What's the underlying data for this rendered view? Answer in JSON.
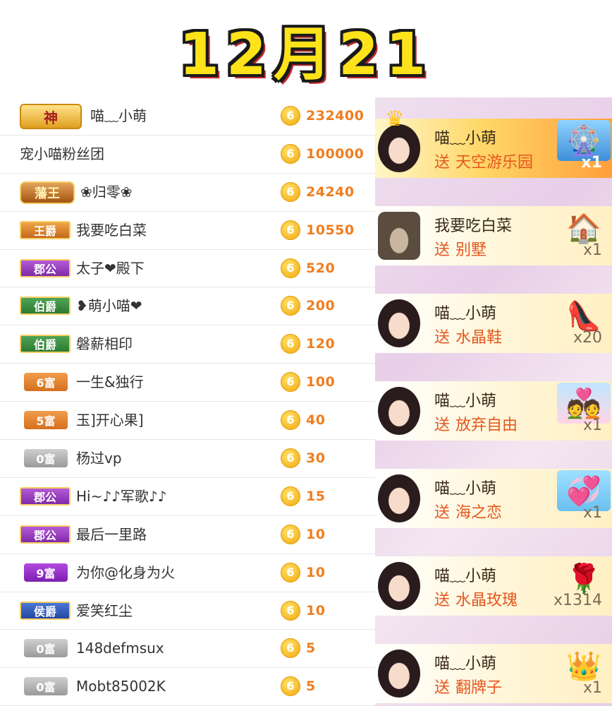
{
  "title": "12月21",
  "coin_glyph": "6",
  "ranking": [
    {
      "badge": "神",
      "badge_type": "god",
      "name": "喵﹏小萌",
      "score": "232400"
    },
    {
      "badge": "",
      "badge_type": "none",
      "name": "宠小喵粉丝团",
      "score": "100000"
    },
    {
      "badge": "藩王",
      "badge_type": "king",
      "name": "❀归零❀",
      "score": "24240"
    },
    {
      "badge": "王爵",
      "badge_type": "wang",
      "name": "我要吃白菜",
      "score": "10550"
    },
    {
      "badge": "郡公",
      "badge_type": "jun",
      "name": "太子❤殿下",
      "score": "520"
    },
    {
      "badge": "伯爵",
      "badge_type": "bo",
      "name": "❥萌小喵❤",
      "score": "200"
    },
    {
      "badge": "伯爵",
      "badge_type": "bo",
      "name": "磐薪相印",
      "score": "120"
    },
    {
      "badge": "6富",
      "badge_type": "fu6",
      "name": "一生&独行",
      "score": "100"
    },
    {
      "badge": "5富",
      "badge_type": "fu5",
      "name": "玉]开心果]",
      "score": "40"
    },
    {
      "badge": "0富",
      "badge_type": "fu0",
      "name": "杨过vp",
      "score": "30"
    },
    {
      "badge": "郡公",
      "badge_type": "jun",
      "name": "Hi~♪♪军歌♪♪",
      "score": "15"
    },
    {
      "badge": "郡公",
      "badge_type": "jun",
      "name": "最后一里路",
      "score": "10"
    },
    {
      "badge": "9富",
      "badge_type": "fu9",
      "name": "为你@化身为火",
      "score": "10"
    },
    {
      "badge": "侯爵",
      "badge_type": "hou",
      "name": "爱笑红尘",
      "score": "10"
    },
    {
      "badge": "0富",
      "badge_type": "fu0",
      "name": "148defmsux",
      "score": "5"
    },
    {
      "badge": "0富",
      "badge_type": "fu0",
      "name": "Mobt85002K",
      "score": "5"
    }
  ],
  "gifts": [
    {
      "user": "喵﹏小萌",
      "send_label": "送",
      "gift": "天空游乐园",
      "count": "x1",
      "icon": "amusement-park-icon",
      "avatar": "female",
      "crown": true
    },
    {
      "user": "我要吃白菜",
      "send_label": "送",
      "gift": "别墅",
      "count": "x1",
      "icon": "villa-icon",
      "avatar": "male",
      "crown": false
    },
    {
      "user": "喵﹏小萌",
      "send_label": "送",
      "gift": "水晶鞋",
      "count": "x20",
      "icon": "crystal-shoe-icon",
      "avatar": "female",
      "crown": false
    },
    {
      "user": "喵﹏小萌",
      "send_label": "送",
      "gift": "放弃自由",
      "count": "x1",
      "icon": "couple-icon",
      "avatar": "female",
      "crown": false
    },
    {
      "user": "喵﹏小萌",
      "send_label": "送",
      "gift": "海之恋",
      "count": "x1",
      "icon": "sea-love-icon",
      "avatar": "female",
      "crown": false
    },
    {
      "user": "喵﹏小萌",
      "send_label": "送",
      "gift": "水晶玫瑰",
      "count": "x1314",
      "icon": "crystal-rose-icon",
      "avatar": "female",
      "crown": false
    },
    {
      "user": "喵﹏小萌",
      "send_label": "送",
      "gift": "翻牌子",
      "count": "x1",
      "icon": "emperor-icon",
      "avatar": "female",
      "crown": false
    }
  ],
  "colors": {
    "title_fill": "#ffe31a",
    "score": "#f07d1e",
    "gift_send": "#e4571e",
    "feed_bg": "#efe0ef"
  }
}
